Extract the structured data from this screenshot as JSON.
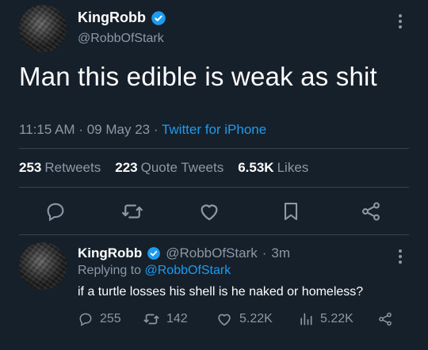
{
  "main_tweet": {
    "display_name": "KingRobb",
    "handle": "@RobbOfStark",
    "text": "Man this edible is weak as shit",
    "time": "11:15 AM",
    "date": "09 May 23",
    "separator": "·",
    "source": "Twitter for iPhone",
    "stats": {
      "retweets_count": "253",
      "retweets_label": "Retweets",
      "quotes_count": "223",
      "quotes_label": "Quote Tweets",
      "likes_count": "6.53K",
      "likes_label": "Likes"
    },
    "action_icons": [
      "reply-icon",
      "retweet-icon",
      "like-icon",
      "bookmark-icon",
      "share-icon"
    ]
  },
  "reply": {
    "display_name": "KingRobb",
    "handle": "@RobbOfStark",
    "age": "3m",
    "separator": "·",
    "replying_prefix": "Replying to",
    "replying_to": "@RobbOfStark",
    "text": "if a turtle losses his shell is he naked or homeless?",
    "counts": {
      "replies": "255",
      "retweets": "142",
      "likes": "5.22K",
      "views": "5.22K"
    }
  },
  "colors": {
    "background": "#15202b",
    "text": "#ffffff",
    "muted": "#8b98a5",
    "accent": "#1d9bf0",
    "divider": "#38444d"
  }
}
